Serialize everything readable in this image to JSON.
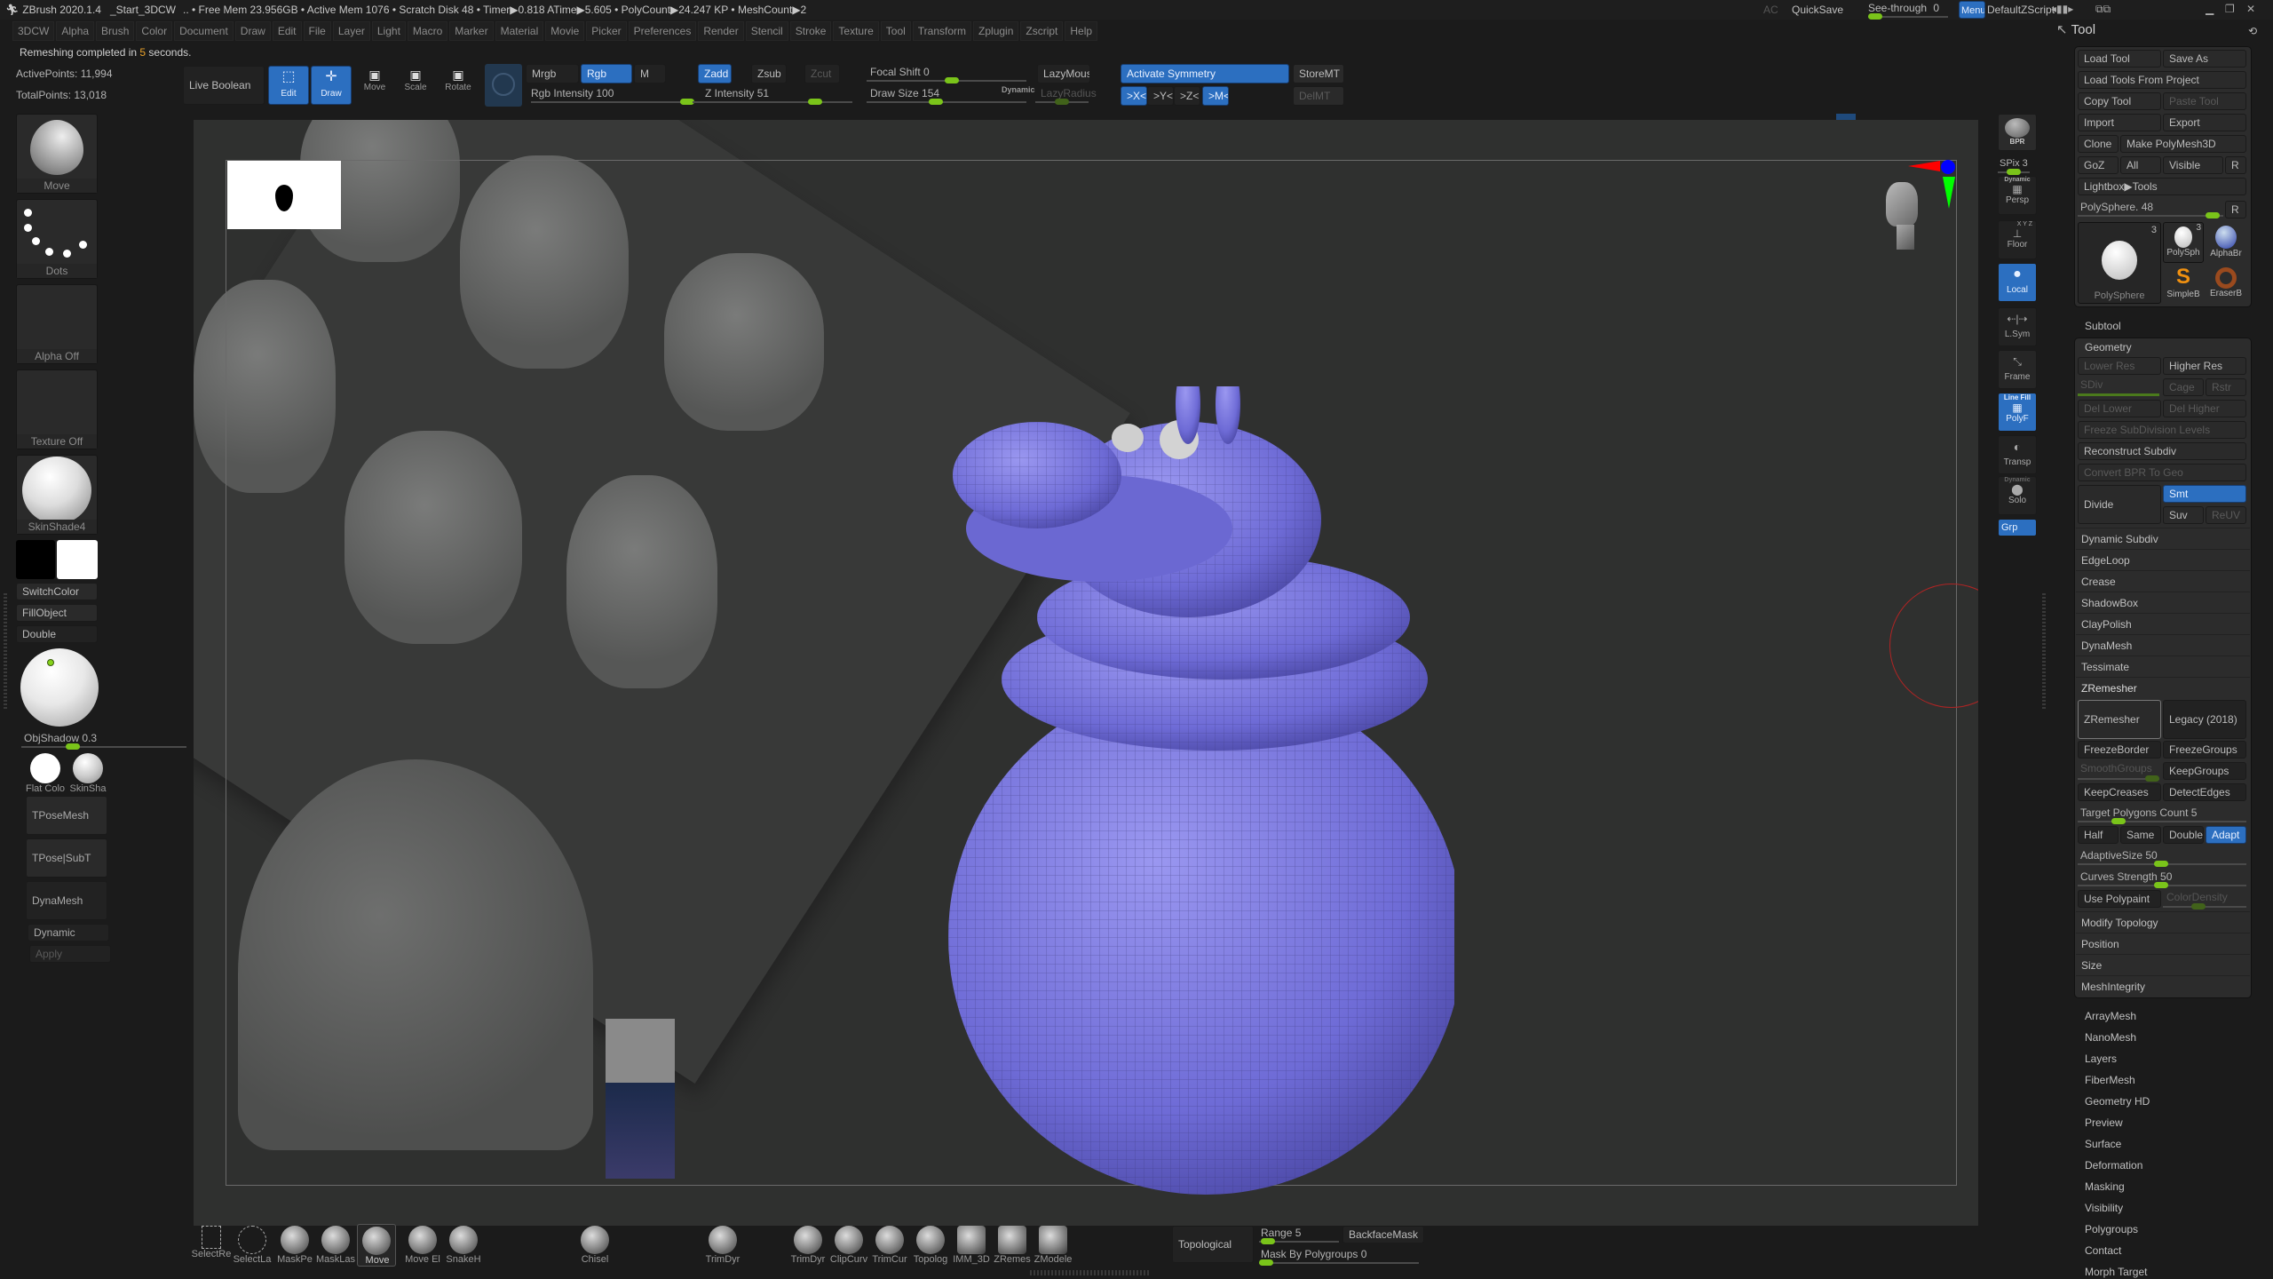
{
  "titlebar": {
    "app": "ZBrush 2020.1.4",
    "project": "_Start_3DCW",
    "stats": ".. • Free Mem 23.956GB • Active Mem 1076 • Scratch Disk 48 • Timer▶0.818 ATime▶5.605 • PolyCount▶24.247 KP • MeshCount▶2",
    "ac": "AC",
    "quicksave": "QuickSave",
    "see_through": "See-through",
    "see_through_value": "0",
    "menus": "Menus",
    "default_zscript": "DefaultZScript"
  },
  "menubar": [
    "3DCW",
    "Alpha",
    "Brush",
    "Color",
    "Document",
    "Draw",
    "Edit",
    "File",
    "Layer",
    "Light",
    "Macro",
    "Marker",
    "Material",
    "Movie",
    "Picker",
    "Preferences",
    "Render",
    "Stencil",
    "Stroke",
    "Texture",
    "Tool",
    "Transform",
    "Zplugin",
    "Zscript",
    "Help"
  ],
  "notification": {
    "prefix": "Remeshing completed in ",
    "value": "5",
    "suffix": " seconds."
  },
  "stats": {
    "active_points": "ActivePoints: 11,994",
    "total_points": "TotalPoints: 13,018"
  },
  "toptoolbar": {
    "live_boolean": "Live Boolean",
    "edit": "Edit",
    "draw": "Draw",
    "move": "Move",
    "scale": "Scale",
    "rotate": "Rotate",
    "mrgb": "Mrgb",
    "rgb": "Rgb",
    "m": "M",
    "rgb_intensity": "Rgb Intensity 100",
    "rgb_intensity_value": 100,
    "zadd": "Zadd",
    "zsub": "Zsub",
    "zcut": "Zcut",
    "z_intensity": "Z Intensity 51",
    "z_intensity_value": 51,
    "focal_shift": "Focal Shift 0",
    "draw_size": "Draw Size 154",
    "dynamic": "Dynamic",
    "lazymouse": "LazyMouse",
    "lazyradius": "LazyRadius",
    "activate_symmetry": "Activate Symmetry",
    "x": ">X<",
    "y": ">Y<",
    "z": ">Z<",
    "m_sym": ">M<",
    "storemt": "StoreMT",
    "delmt": "DelMT"
  },
  "leftshelf": {
    "brush": "Move",
    "stroke": "Dots",
    "alpha": "Alpha Off",
    "texture": "Texture Off",
    "material": "SkinShade4",
    "switch_color": "SwitchColor",
    "fill_object": "FillObject",
    "double": "Double",
    "obj_shadow": "ObjShadow 0.3",
    "flat_color": "Flat Colo",
    "skin_shade": "SkinSha",
    "tpose_mesh": "TPoseMesh",
    "tpose_subt": "TPose|SubT",
    "dynamesh": "DynaMesh",
    "dynamic": "Dynamic",
    "apply": "Apply"
  },
  "rightshelf": {
    "bpr": "BPR",
    "spix": "SPix 3",
    "persp_top": "Dynamic",
    "persp": "Persp",
    "floor_top": "X Y Z",
    "floor": "Floor",
    "local": "Local",
    "lsym": "L.Sym",
    "frame": "Frame",
    "polyf_top": "Line Fill",
    "polyf": "PolyF",
    "transp": "Transp",
    "solo_top": "Dynamic",
    "solo": "Solo",
    "grp": "Grp"
  },
  "toolpanel": {
    "title": "Tool",
    "load_tool": "Load Tool",
    "save_as": "Save As",
    "load_tools_from_project": "Load Tools From Project",
    "copy_tool": "Copy Tool",
    "paste_tool": "Paste Tool",
    "import": "Import",
    "export": "Export",
    "clone": "Clone",
    "make_polymesh": "Make PolyMesh3D",
    "goz": "GoZ",
    "all": "All",
    "visible": "Visible",
    "r": "R",
    "lightbox_tools": "Lightbox▶Tools",
    "polysphere_slider": "PolySphere. 48",
    "thumbs": [
      {
        "name": "PolySphere",
        "count": "3"
      },
      {
        "name": "PolySph",
        "count": "3"
      },
      {
        "name": "AlphaBr"
      },
      {
        "name": "SimpleB"
      },
      {
        "name": "EraserB"
      }
    ],
    "subtool": "Subtool",
    "geometry": "Geometry",
    "lower_res": "Lower Res",
    "higher_res": "Higher Res",
    "sdiv": "SDiv",
    "cage": "Cage",
    "rstr": "Rstr",
    "del_lower": "Del Lower",
    "del_higher": "Del Higher",
    "freeze_subdiv": "Freeze SubDivision Levels",
    "reconstruct_subdiv": "Reconstruct Subdiv",
    "convert_bpr": "Convert BPR To Geo",
    "divide": "Divide",
    "smt": "Smt",
    "suv": "Suv",
    "reuv": "ReUV",
    "geometry_sections": [
      "Dynamic Subdiv",
      "EdgeLoop",
      "Crease",
      "ShadowBox",
      "ClayPolish",
      "DynaMesh",
      "Tessimate"
    ],
    "zremesher_header": "ZRemesher",
    "zremesher": "ZRemesher",
    "legacy": "Legacy (2018)",
    "freeze_border": "FreezeBorder",
    "freeze_groups": "FreezeGroups",
    "smooth_groups": "SmoothGroups",
    "keep_groups": "KeepGroups",
    "keep_creases": "KeepCreases",
    "detect_edges": "DetectEdges",
    "target_polygons": "Target Polygons Count 5",
    "half": "Half",
    "same": "Same",
    "double": "Double",
    "adapt": "Adapt",
    "adaptive_size": "AdaptiveSize 50",
    "curves_strength": "Curves Strength 50",
    "use_polypaint": "Use Polypaint",
    "color_density": "ColorDensity",
    "geometry_tail": [
      "Modify Topology",
      "Position",
      "Size",
      "MeshIntegrity"
    ],
    "sections": [
      "ArrayMesh",
      "NanoMesh",
      "Layers",
      "FiberMesh",
      "Geometry HD",
      "Preview",
      "Surface",
      "Deformation",
      "Masking",
      "Visibility",
      "Polygroups",
      "Contact",
      "Morph Target"
    ]
  },
  "bottomshelf": {
    "brushes": [
      "SelectRe",
      "SelectLa",
      "MaskPe",
      "MaskLas",
      "Move",
      "Move El",
      "SnakeH",
      "Chisel",
      "TrimDyr",
      "TrimDyr",
      "ClipCurv",
      "TrimCur",
      "Topolog",
      "IMM_3D",
      "ZRemes",
      "ZModele"
    ],
    "topological": "Topological",
    "range": "Range 5",
    "backface_mask": "BackfaceMask",
    "mask_by_polygroups": "Mask By Polygroups 0"
  },
  "colors": {
    "accent_blue": "#2c6fc0",
    "slider_green": "#7ac41a",
    "mesh_purple": "#7b78e0"
  }
}
